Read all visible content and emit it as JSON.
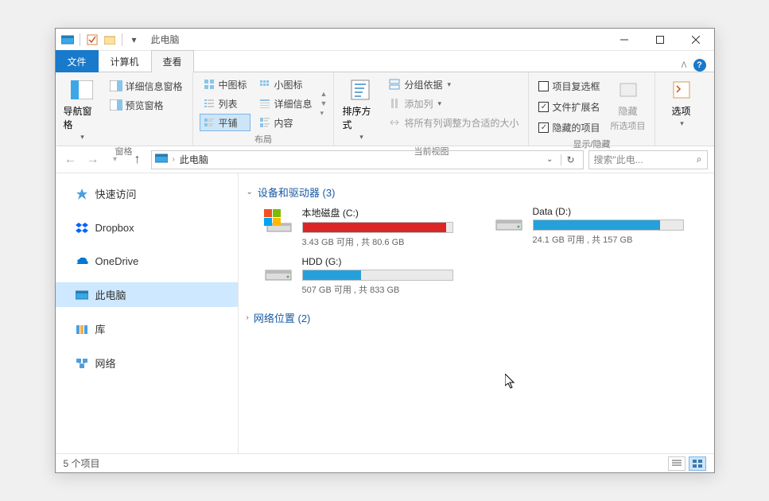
{
  "title": "此电脑",
  "tabs": {
    "file": "文件",
    "computer": "计算机",
    "view": "查看"
  },
  "ribbon": {
    "panes": {
      "label": "窗格",
      "nav": "导航窗格",
      "details_pane": "详细信息窗格",
      "preview_pane": "预览窗格"
    },
    "layout": {
      "label": "布局",
      "medium": "中图标",
      "small": "小图标",
      "list": "列表",
      "details": "详细信息",
      "tiles": "平铺",
      "content": "内容"
    },
    "current_view": {
      "label": "当前视图",
      "sort": "排序方式",
      "group": "分组依据",
      "add_col": "添加列",
      "fit_cols": "将所有列调整为合适的大小"
    },
    "show_hide": {
      "label": "显示/隐藏",
      "checkboxes": "项目复选框",
      "extensions": "文件扩展名",
      "hidden": "隐藏的项目",
      "hide_btn": "隐藏",
      "hide_sub": "所选项目"
    },
    "options": "选项"
  },
  "breadcrumb": "此电脑",
  "search_placeholder": "搜索\"此电...",
  "sidebar": {
    "quick": "快速访问",
    "dropbox": "Dropbox",
    "onedrive": "OneDrive",
    "thispc": "此电脑",
    "libraries": "库",
    "network": "网络"
  },
  "groups": {
    "drives": {
      "label": "设备和驱动器",
      "count": 3
    },
    "network": {
      "label": "网络位置",
      "count": 2
    }
  },
  "drives": [
    {
      "name": "本地磁盘 (C:)",
      "free": "3.43 GB",
      "total": "80.6 GB",
      "fill_pct": 96,
      "color": "red",
      "os": true
    },
    {
      "name": "Data (D:)",
      "free": "24.1 GB",
      "total": "157 GB",
      "fill_pct": 85,
      "color": "blue",
      "os": false
    },
    {
      "name": "HDD (G:)",
      "free": "507 GB",
      "total": "833 GB",
      "fill_pct": 39,
      "color": "blue",
      "os": false
    }
  ],
  "status": {
    "items_label": "个项目",
    "count": 5
  }
}
